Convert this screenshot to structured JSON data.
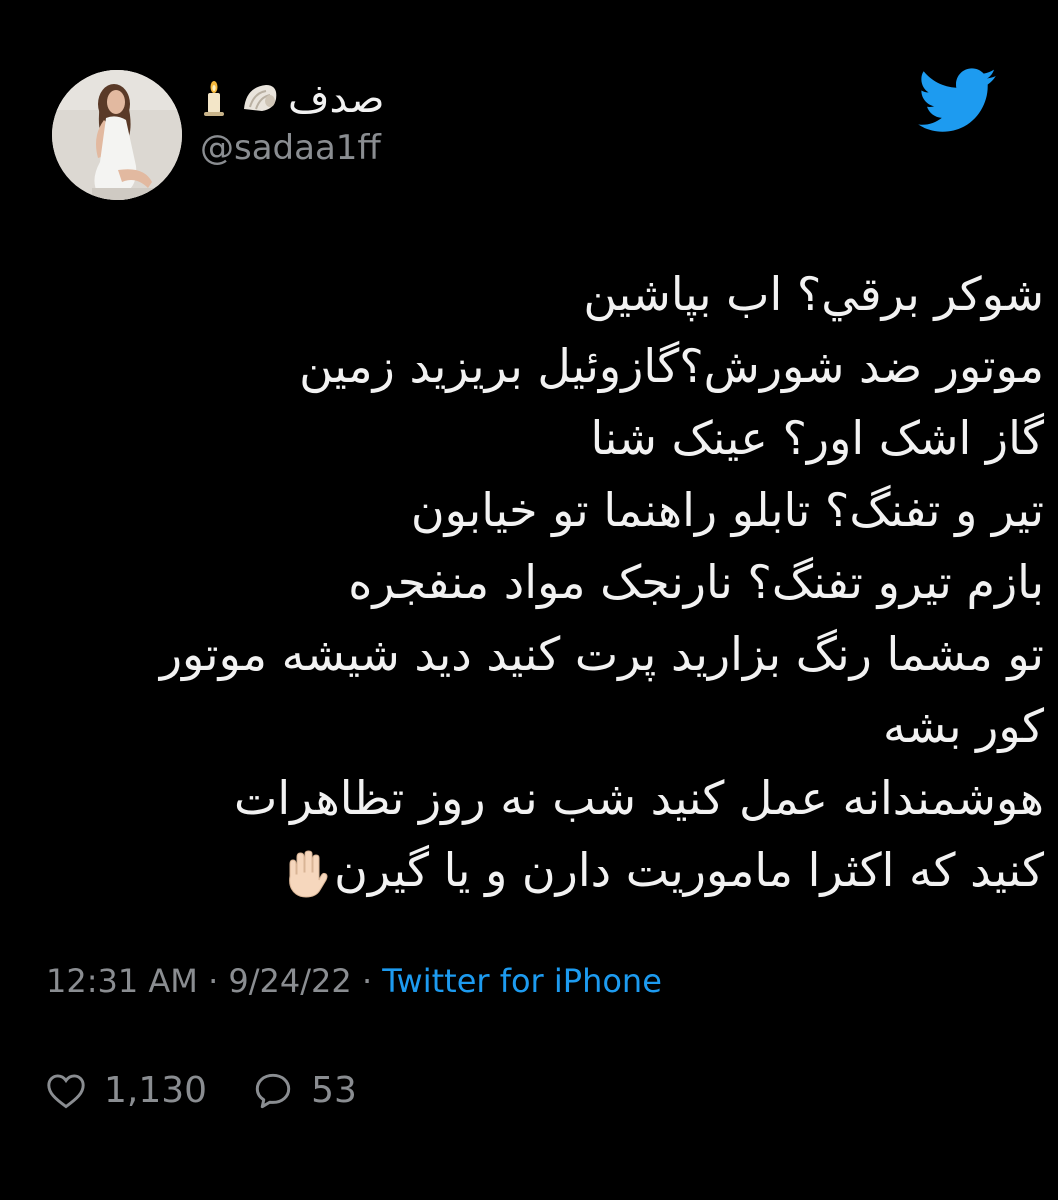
{
  "user": {
    "display_name": "صدف",
    "handle": "@sadaa1ff",
    "name_emojis": [
      "shell-emoji",
      "candle-emoji"
    ]
  },
  "tweet": {
    "lines": [
      "شوكر برقي؟ اب بپاشين",
      "موتور ضد شورش؟گازوئیل بریزید زمین",
      "گاز اشک اور؟ عینک شنا",
      "تیر و تفنگ؟ تابلو راهنما تو خیابون",
      "بازم تیرو تفنگ؟ نارنجک مواد منفجره",
      "تو مشما رنگ بزارید پرت کنید دید شیشه موتور",
      "کور بشه",
      "هوشمندانه عمل کنید شب نه روز تظاهرات",
      "کنید که اکثرا ماموریت دارن و یا گیرن"
    ],
    "trailing_emoji": "raised-hand-emoji"
  },
  "meta": {
    "time": "12:31 AM",
    "separator": "·",
    "date": "9/24/22",
    "source": "Twitter for iPhone"
  },
  "actions": {
    "likes": "1,130",
    "replies": "53"
  },
  "colors": {
    "background": "#000000",
    "twitter_blue": "#1d9bf0",
    "text": "#f2f2f2",
    "muted": "#8a8d91"
  }
}
